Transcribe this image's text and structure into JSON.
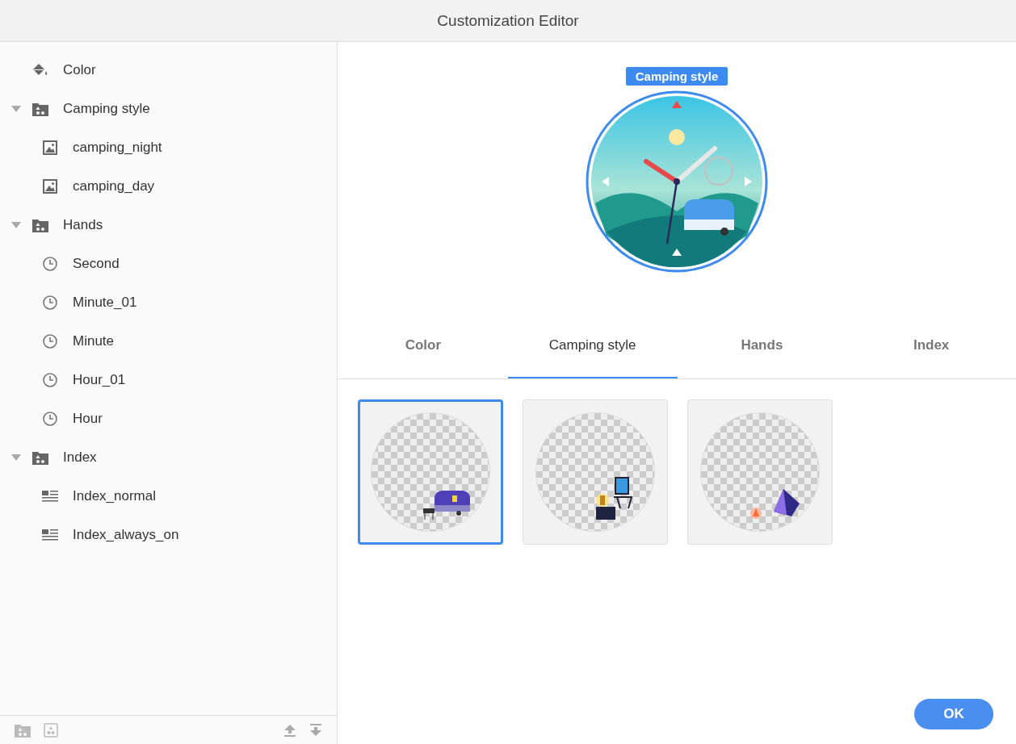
{
  "window": {
    "title": "Customization Editor"
  },
  "tree": [
    {
      "label": "Color",
      "kind": "paint"
    },
    {
      "label": "Camping style",
      "kind": "folder",
      "expanded": true,
      "children": [
        {
          "label": "camping_night",
          "kind": "image"
        },
        {
          "label": "camping_day",
          "kind": "image"
        }
      ]
    },
    {
      "label": "Hands",
      "kind": "folder",
      "expanded": true,
      "children": [
        {
          "label": "Second",
          "kind": "clock"
        },
        {
          "label": "Minute_01",
          "kind": "clock"
        },
        {
          "label": "Minute",
          "kind": "clock"
        },
        {
          "label": "Hour_01",
          "kind": "clock"
        },
        {
          "label": "Hour",
          "kind": "clock"
        }
      ]
    },
    {
      "label": "Index",
      "kind": "folder",
      "expanded": true,
      "children": [
        {
          "label": "Index_normal",
          "kind": "index"
        },
        {
          "label": "Index_always_on",
          "kind": "index"
        }
      ]
    }
  ],
  "preview": {
    "label": "Camping style"
  },
  "tabs": [
    {
      "label": "Color",
      "selected": false
    },
    {
      "label": "Camping style",
      "selected": true
    },
    {
      "label": "Hands",
      "selected": false
    },
    {
      "label": "Index",
      "selected": false
    }
  ],
  "options": [
    {
      "kind": "trailer",
      "selected": true
    },
    {
      "kind": "chair",
      "selected": false
    },
    {
      "kind": "tent",
      "selected": false
    }
  ],
  "buttons": {
    "ok": "OK"
  }
}
